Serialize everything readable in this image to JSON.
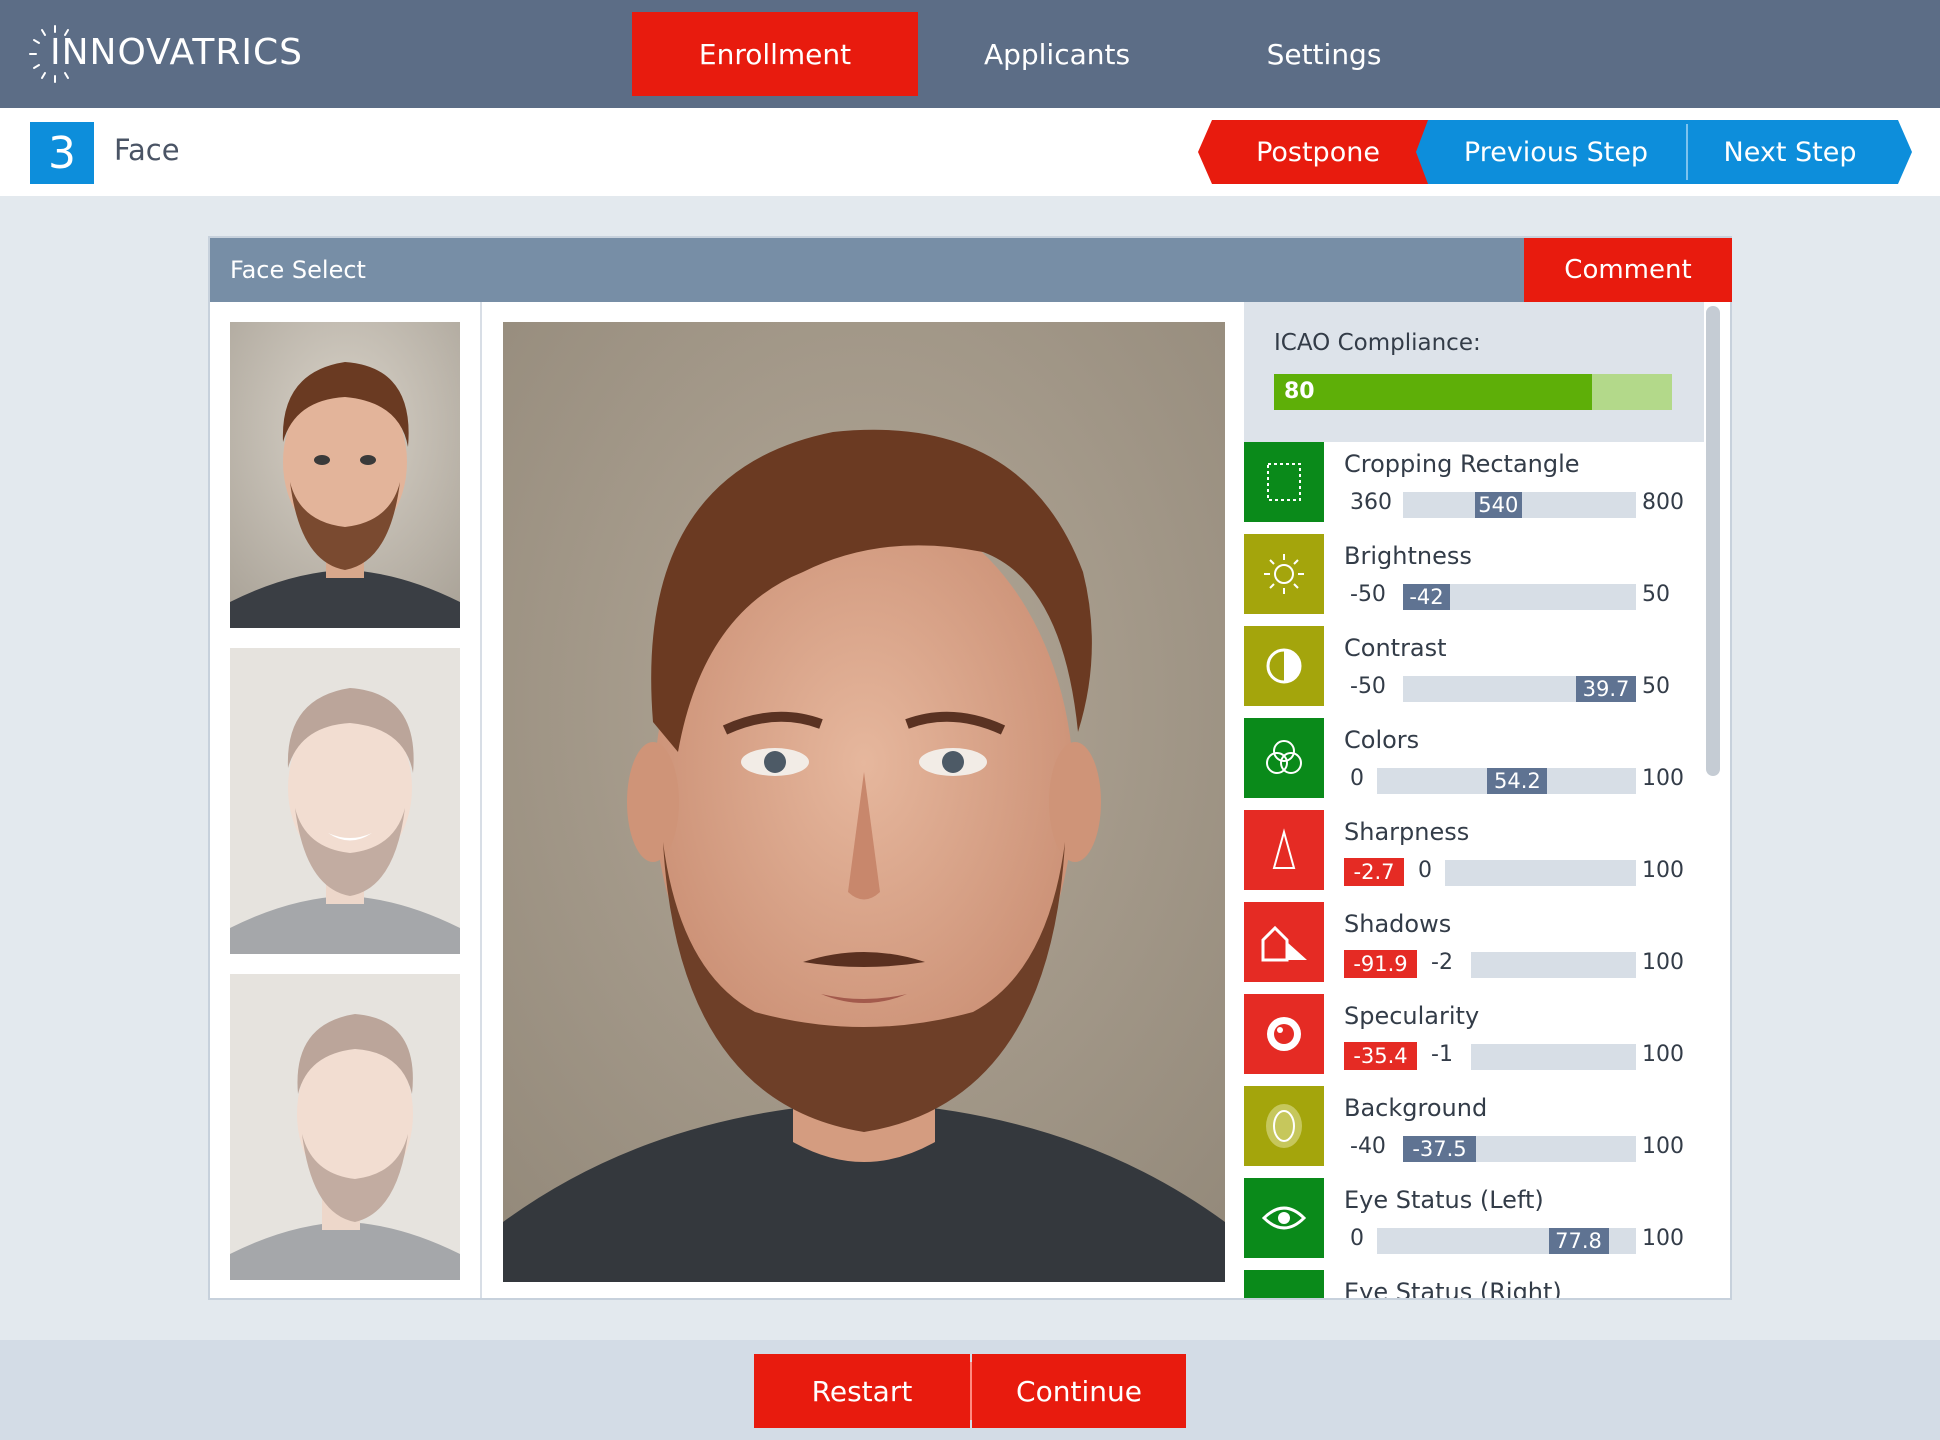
{
  "brand": {
    "logo_text": "INNOVATRICS"
  },
  "nav": [
    {
      "label": "Enrollment",
      "active": true
    },
    {
      "label": "Applicants",
      "active": false
    },
    {
      "label": "Settings",
      "active": false
    }
  ],
  "step": {
    "number": "3",
    "title": "Face"
  },
  "actions": {
    "postpone": "Postpone",
    "previous": "Previous Step",
    "next": "Next Step"
  },
  "panel": {
    "title": "Face Select",
    "comment": "Comment"
  },
  "compliance": {
    "label": "ICAO Compliance:",
    "value": "80",
    "percent": 0.8
  },
  "metrics": [
    {
      "name": "Cropping Rectangle",
      "min": "360",
      "max": "800",
      "value": "540",
      "icon": "crop-icon",
      "color": "#0a8a1a"
    },
    {
      "name": "Brightness",
      "min": "-50",
      "max": "50",
      "value": "-42",
      "icon": "sun-icon",
      "color": "#a4a50c"
    },
    {
      "name": "Contrast",
      "min": "-50",
      "max": "50",
      "value": "39.7",
      "icon": "contrast-icon",
      "color": "#a4a50c"
    },
    {
      "name": "Colors",
      "min": "0",
      "max": "100",
      "value": "54.2",
      "icon": "colors-icon",
      "color": "#0a8a1a"
    },
    {
      "name": "Sharpness",
      "min": "0",
      "max": "100",
      "value": "-2.7",
      "icon": "sharpness-icon",
      "color": "#e52b24",
      "out_of_range": true
    },
    {
      "name": "Shadows",
      "min": "-2",
      "max": "100",
      "value": "-91.9",
      "icon": "shadows-icon",
      "color": "#e52b24",
      "out_of_range": true
    },
    {
      "name": "Specularity",
      "min": "-1",
      "max": "100",
      "value": "-35.4",
      "icon": "specularity-icon",
      "color": "#e52b24",
      "out_of_range": true
    },
    {
      "name": "Background",
      "min": "-40",
      "max": "100",
      "value": "-37.5",
      "icon": "background-icon",
      "color": "#a4a50c"
    },
    {
      "name": "Eye Status (Left)",
      "min": "0",
      "max": "100",
      "value": "77.8",
      "icon": "eye-icon",
      "color": "#0a8a1a"
    },
    {
      "name": "Eye Status (Right)",
      "min": "",
      "max": "",
      "value": "",
      "icon": "eye-icon",
      "color": "#0a8a1a"
    }
  ],
  "footer": {
    "restart": "Restart",
    "continue": "Continue"
  }
}
